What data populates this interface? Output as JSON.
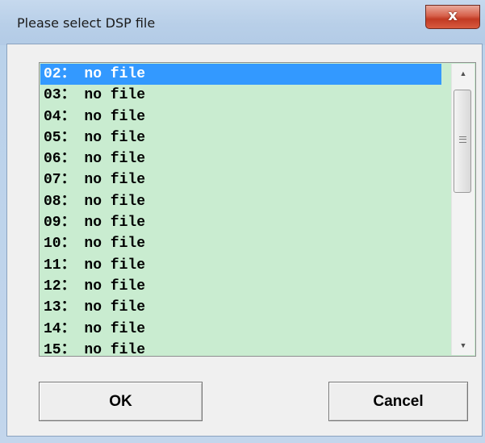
{
  "window": {
    "title": "Please select DSP file",
    "close_symbol": "x"
  },
  "file_list": {
    "selected_index": 0,
    "items": [
      "02： no file",
      "03： no file",
      "04： no file",
      "05： no file",
      "06： no file",
      "07： no file",
      "08： no file",
      "09： no file",
      "10： no file",
      "11： no file",
      "12： no file",
      "13： no file",
      "14： no file",
      "15： no file"
    ]
  },
  "scrollbar": {
    "up_arrow_icon": "scroll-up-arrow",
    "down_arrow_icon": "scroll-down-arrow",
    "up_symbol": "▲",
    "down_symbol": "▼"
  },
  "buttons": {
    "ok_label": "OK",
    "cancel_label": "Cancel"
  },
  "colors": {
    "list_background": "#c9ecd0",
    "selection": "#3399ff",
    "close_button": "#c23a23",
    "title_bar": "#b9d1ea"
  }
}
